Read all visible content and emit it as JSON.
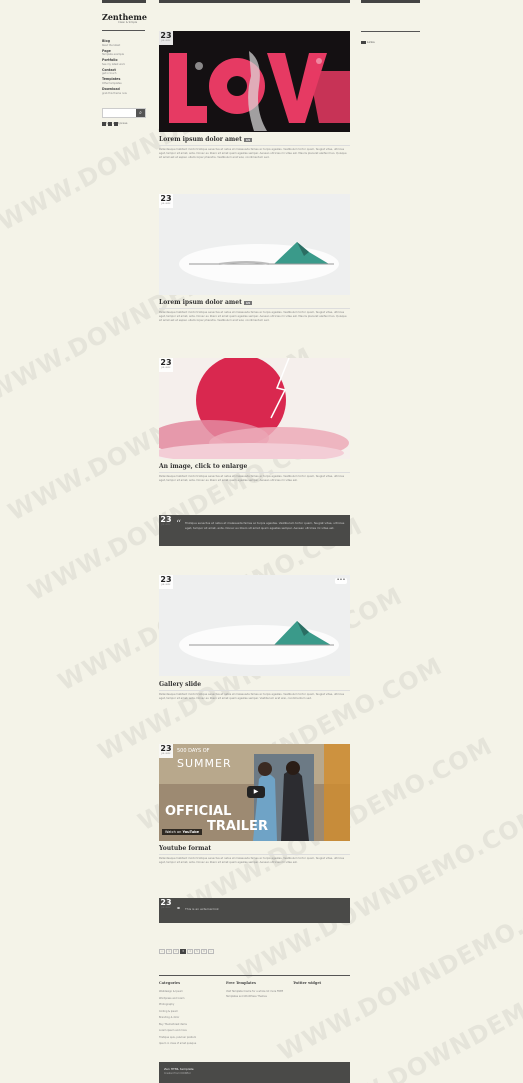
{
  "watermark": "WWW.DOWNDEMO.COM",
  "logo": "Zentheme",
  "tagline": "Clean & Simple",
  "menu": [
    {
      "title": "Blog",
      "sub": "Read the latest"
    },
    {
      "title": "Page",
      "sub": "Template example"
    },
    {
      "title": "Portfolio",
      "sub": "See my latest work"
    },
    {
      "title": "Contact",
      "sub": "get in touch"
    },
    {
      "title": "Templates",
      "sub": "Other templates"
    },
    {
      "title": "Download",
      "sub": "grab this theme now"
    }
  ],
  "search": {
    "placeholder": "Type and press"
  },
  "right_sidebar": {
    "item": "Links"
  },
  "posts": [
    {
      "date": "23",
      "month": "JUL 2012",
      "title": "Lorem ipsum dolor amet",
      "comments": "13",
      "body": "Pellentesque habitant morbi tristique senectus et netus et malesuada fames ac turpis egestas. Vestibulum tortor quam, feugiat vitae, ultricies eget, tempor sit amet, ante. Donec eu libero sit amet quam egestas semper. Aenean ultricies mi vitae est. Mauris placerat eleifend leo. Quisque sit amet est et sapien ullamcorper pharetra. Vestibulum erat wisi, condimentum sed."
    },
    {
      "date": "23",
      "month": "JUL 2012",
      "title": "Lorem ipsum dolor amet",
      "comments": "13",
      "body": "Pellentesque habitant morbi tristique senectus et netus et malesuada fames ac turpis egestas. Vestibulum tortor quam, feugiat vitae, ultricies eget, tempor sit amet, ante. Donec eu libero sit amet quam egestas semper. Aenean ultricies mi vitae est. Mauris placerat eleifend leo. Quisque sit amet est et sapien ullamcorper pharetra. Vestibulum erat wisi, condimentum sed."
    },
    {
      "date": "23",
      "month": "JUL 2012",
      "title": "An image, click to enlarge",
      "body": "Pellentesque habitant morbi tristique senectus et netus et malesuada fames ac turpis egestas. Vestibulum tortor quam, feugiat vitae, ultricies eget, tempor sit amet, ante. Donec eu libero sit amet quam egestas semper. Aenean ultricies mi vitae est."
    },
    {
      "date": "23",
      "month": "JUL 2012",
      "quote": "Tristique senectus et netus et malesuada fames ac turpis egestas. Vestibulum tortor quam, feugiat vitae, ultricies eget, tempor sit amet, ante. Donec eu libero sit amet quam egestas semper. Aenean ultricies mi vitae est."
    },
    {
      "date": "23",
      "month": "JUL 2012",
      "title": "Gallery slide",
      "body": "Pellentesque habitant morbi tristique senectus et netus et malesuada fames ac turpis egestas. Vestibulum tortor quam, feugiat vitae, ultricies eget, tempor sit amet, ante. Donec eu libero sit amet quam egestas semper. Vestibulum erat wisi, condimentum sed."
    },
    {
      "date": "23",
      "month": "JUL 2012",
      "title": "Youtube format",
      "video_text": {
        "line1": "500 DAYS OF",
        "line2": "SUMMER",
        "line3": "OFFICIAL",
        "line4": "TRAILER",
        "watch": "Watch on",
        "yt": "YouTube"
      },
      "body": "Pellentesque habitant morbi tristique senectus et netus et malesuada fames ac turpis egestas. Vestibulum tortor quam, feugiat vitae, ultricies eget, tempor sit amet, ante. Donec eu libero sit amet quam egestas semper. Aenean ultricies mi vitae est."
    },
    {
      "date": "23",
      "month": "JUL 2012",
      "link": "This is an external link"
    }
  ],
  "pager": [
    "«",
    "1",
    "2",
    "3",
    "4",
    "5",
    "6",
    "»"
  ],
  "footer": {
    "categories": {
      "title": "Categories",
      "items": [
        "Webdesign & Ipsum",
        "Wordpress and lorem",
        "Photography",
        "Coding & ipsum",
        "Branding & dolor",
        "Buy Themeforest items",
        "Lorem ipsum and more",
        "Tristique quis, pulvinar pretium",
        "Ipsum in class of amet quisque"
      ]
    },
    "templates": {
      "title": "Free Templates",
      "text": "Visit Template Creme for a whole lot more FREE Templates and WordPress Themes"
    },
    "twitter": {
      "title": "Twitter widget"
    },
    "credit1": "Zen HTML template",
    "credit2": "Created from IRONEAI"
  }
}
